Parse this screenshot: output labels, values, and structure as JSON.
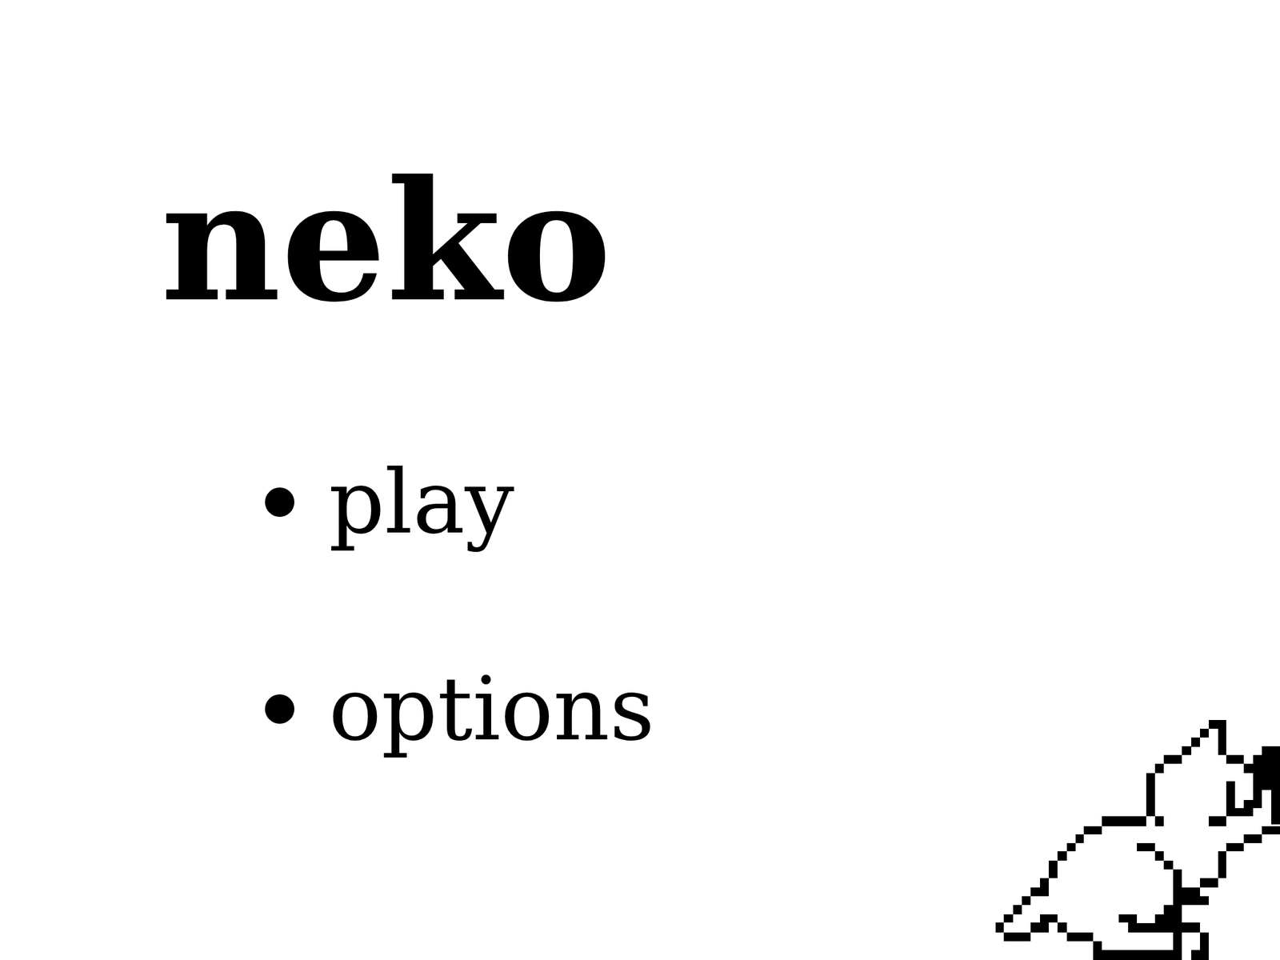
{
  "title": "neko",
  "menu": [
    {
      "label": "play"
    },
    {
      "label": "options"
    }
  ]
}
